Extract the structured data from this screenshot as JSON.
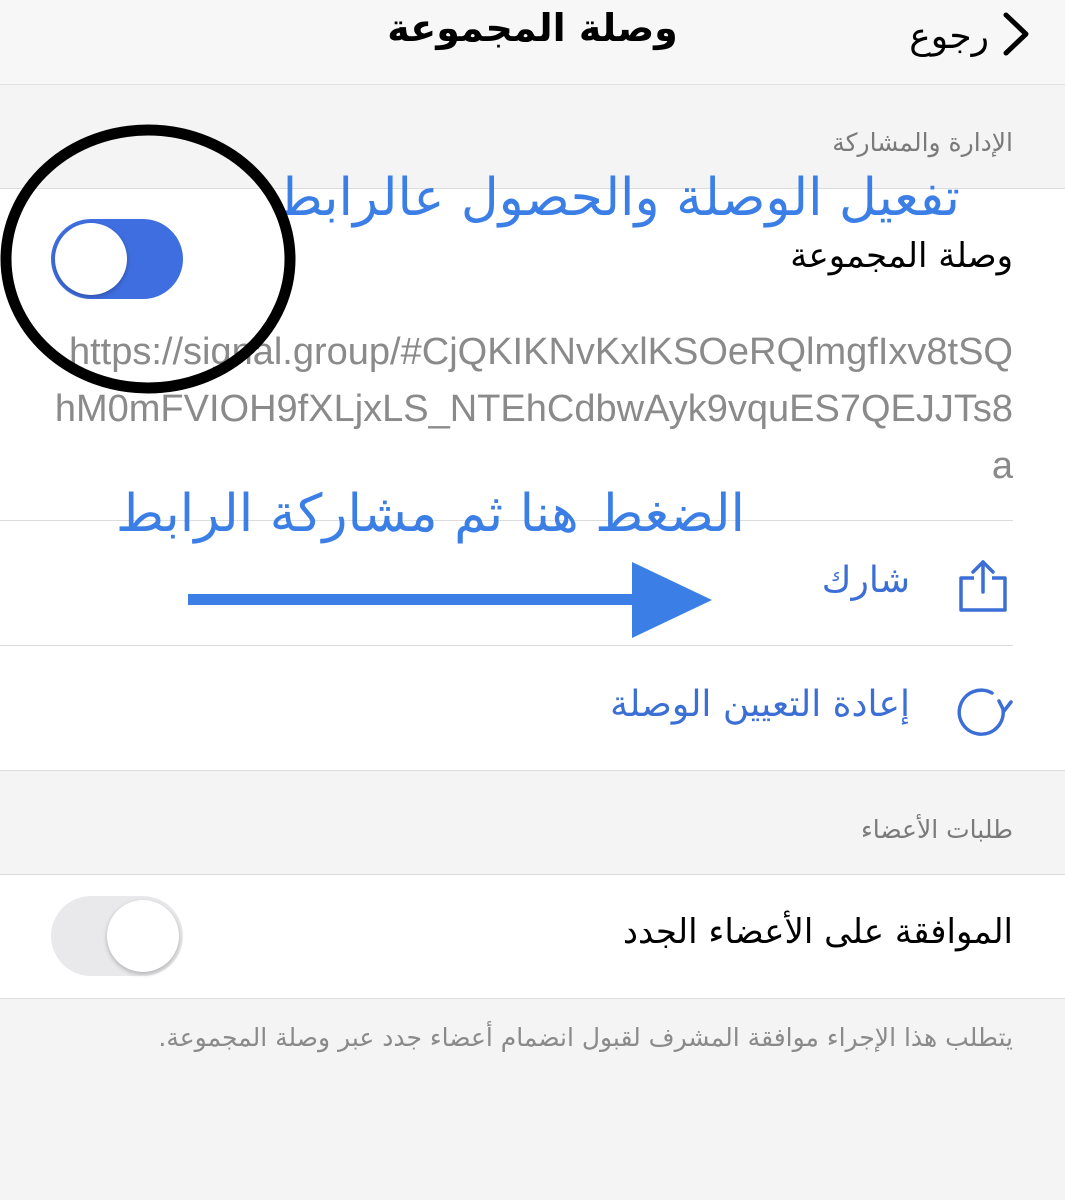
{
  "nav": {
    "title": "وصلة المجموعة",
    "back_label": "رجوع",
    "back_icon": "chevron-right-icon"
  },
  "management": {
    "section_header": "الإدارة والمشاركة",
    "group_link_label": "وصلة المجموعة",
    "group_link_enabled": true,
    "link_url": "https://signal.group/#CjQKIKNvKxlKSOeRQlmgfIxv8tSQhM0mFVIOH9fXLjxLS_NTEhCdbwAyk9vquES7QEJJTs8a",
    "share_label": "شارك",
    "share_icon": "share-icon",
    "reset_label": "إعادة التعيين الوصلة",
    "reset_icon": "reset-icon"
  },
  "member_requests": {
    "section_header": "طلبات الأعضاء",
    "approve_label": "الموافقة على الأعضاء الجدد",
    "approve_enabled": false,
    "footer_note": "يتطلب هذا الإجراء موافقة المشرف لقبول انضمام أعضاء جدد عبر وصلة المجموعة."
  },
  "annotations": {
    "enable_note": "تفعيل الوصلة والحصول عالرابط",
    "share_note": "الضغط هنا ثم مشاركة الرابط"
  },
  "colors": {
    "accent": "#3b6fd6",
    "switch_on": "#3f6ee0",
    "switch_off": "#e9e9eb",
    "annotation": "#3b7fe6"
  }
}
